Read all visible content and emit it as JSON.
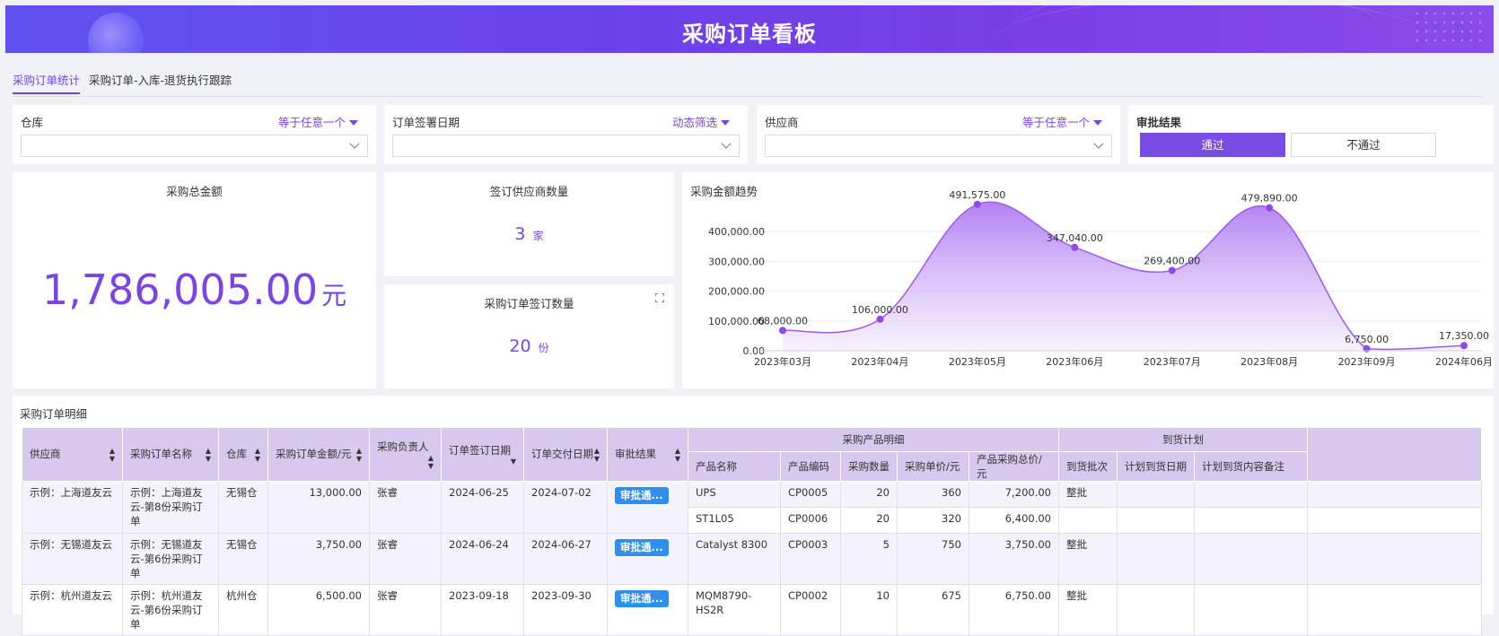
{
  "header": {
    "title": "采购订单看板"
  },
  "tabs": [
    {
      "label": "采购订单统计"
    },
    {
      "label": "采购订单-入库-退货执行跟踪"
    }
  ],
  "filters": {
    "warehouse": {
      "label": "仓库",
      "operator": "等于任意一个",
      "value": ""
    },
    "sign_date": {
      "label": "订单签署日期",
      "operator": "动态筛选",
      "value": ""
    },
    "supplier": {
      "label": "供应商",
      "operator": "等于任意一个",
      "value": ""
    },
    "approval": {
      "label": "审批结果",
      "options": [
        "通过",
        "不通过"
      ],
      "selected": "通过"
    }
  },
  "kpis": {
    "total_amount": {
      "title": "采购总金额",
      "value": "1,786,005.00",
      "unit": "元"
    },
    "supplier_count": {
      "title": "签订供应商数量",
      "value": "3",
      "unit": "家"
    },
    "order_count": {
      "title": "采购订单签订数量",
      "value": "20",
      "unit": "份"
    }
  },
  "trend_title": "采购金额趋势",
  "chart_data": {
    "type": "area",
    "title": "采购金额趋势",
    "categories": [
      "2023年03月",
      "2023年04月",
      "2023年05月",
      "2023年06月",
      "2023年07月",
      "2023年08月",
      "2023年09月",
      "2024年06月"
    ],
    "series": [
      {
        "values": [
          68000,
          106000,
          491575,
          347040,
          269400,
          479890,
          6750,
          17350
        ],
        "labels": [
          "68,000.00",
          "106,000.00",
          "491,575.00",
          "347,040.00",
          "269,400.00",
          "479,890.00",
          "6,750.00",
          "17,350.00"
        ]
      }
    ],
    "yticks": [
      "0.00",
      "100,000.00",
      "200,000.00",
      "300,000.00",
      "400,000.00"
    ],
    "ylim": [
      0,
      500000
    ],
    "grid": true,
    "color": "#9b59f0"
  },
  "table": {
    "title": "采购订单明细",
    "headers": {
      "supplier": "供应商",
      "order_name": "采购订单名称",
      "warehouse": "仓库",
      "amount": "采购订单金额/元",
      "owner": "采购负责人",
      "sign_date": "订单签订日期",
      "delivery_date": "订单交付日期",
      "approval": "审批结果",
      "group_products": "采购产品明细",
      "product_name": "产品名称",
      "product_code": "产品编码",
      "qty": "采购数量",
      "unit_price": "采购单价/元",
      "total_price": "产品采购总价/元",
      "group_arrival": "到货计划",
      "batch": "到货批次",
      "plan_date": "计划到货日期",
      "plan_note": "计划到货内容备注"
    },
    "rows": [
      {
        "supplier": "示例：上海道友云",
        "order_name": "示例：上海道友云-第8份采购订单",
        "warehouse": "无锡仓",
        "amount": "13,000.00",
        "owner": "张睿",
        "sign_date": "2024-06-25",
        "delivery_date": "2024-07-02",
        "approval": "审批通...",
        "items": [
          {
            "product_name": "UPS",
            "product_code": "CP0005",
            "qty": "20",
            "unit_price": "360",
            "total_price": "7,200.00",
            "batch": "整批"
          },
          {
            "product_name": "ST1L05",
            "product_code": "CP0006",
            "qty": "20",
            "unit_price": "320",
            "total_price": "6,400.00",
            "batch": ""
          }
        ]
      },
      {
        "supplier": "示例：无锡道友云",
        "order_name": "示例：无锡道友云-第6份采购订单",
        "warehouse": "无锡仓",
        "amount": "3,750.00",
        "owner": "张睿",
        "sign_date": "2024-06-24",
        "delivery_date": "2024-06-27",
        "approval": "审批通...",
        "items": [
          {
            "product_name": "Catalyst 8300",
            "product_code": "CP0003",
            "qty": "5",
            "unit_price": "750",
            "total_price": "3,750.00",
            "batch": "整批"
          }
        ]
      },
      {
        "supplier": "示例：杭州道友云",
        "order_name": "示例：杭州道友云-第6份采购订单",
        "warehouse": "杭州仓",
        "amount": "6,500.00",
        "owner": "张睿",
        "sign_date": "2023-09-18",
        "delivery_date": "2023-09-30",
        "approval": "审批通...",
        "items": [
          {
            "product_name": "MQM8790-HS2R",
            "product_code": "CP0002",
            "qty": "10",
            "unit_price": "675",
            "total_price": "6,750.00",
            "batch": "整批"
          }
        ]
      }
    ]
  }
}
